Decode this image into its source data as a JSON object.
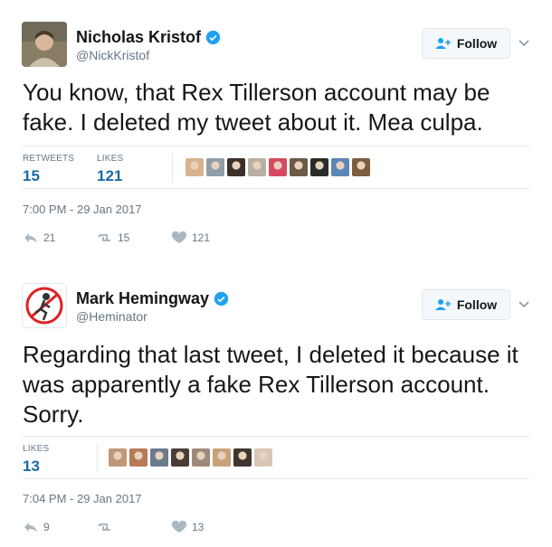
{
  "tweets": [
    {
      "name": "Nicholas Kristof",
      "handle": "@NickKristof",
      "follow_label": "Follow",
      "text": "You know, that Rex Tillerson account may be fake. I deleted my tweet about it. Mea culpa.",
      "stats": [
        {
          "label": "RETWEETS",
          "value": "15"
        },
        {
          "label": "LIKES",
          "value": "121"
        }
      ],
      "timestamp": "7:00 PM - 29 Jan 2017",
      "actions": {
        "reply": "21",
        "retweet": "15",
        "like": "121"
      },
      "face_colors": [
        "#d7b48f",
        "#8f9ea8",
        "#3c2f2a",
        "#b9b0a4",
        "#d64a5f",
        "#6b5a46",
        "#2b2b2b",
        "#5c86b8",
        "#7d5c3f"
      ]
    },
    {
      "name": "Mark Hemingway",
      "handle": "@Heminator",
      "follow_label": "Follow",
      "text": "Regarding that last tweet, I deleted it because it was apparently a fake Rex Tillerson account. Sorry.",
      "stats": [
        {
          "label": "LIKES",
          "value": "13"
        }
      ],
      "timestamp": "7:04 PM - 29 Jan 2017",
      "actions": {
        "reply": "9",
        "retweet": "",
        "like": "13"
      },
      "face_colors": [
        "#c09778",
        "#b87a56",
        "#6c7b8c",
        "#4a3c36",
        "#9c8b7c",
        "#caa27a",
        "#3d3530",
        "#d9c6b4"
      ]
    }
  ],
  "colors": {
    "link": "#1b6aa5",
    "muted": "#657786",
    "verified": "#1da1f2",
    "border": "#e1e8ed"
  }
}
